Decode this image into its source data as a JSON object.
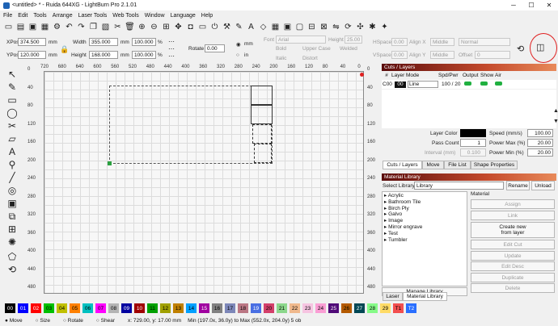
{
  "window": {
    "title": "<untitled> * - Ruida 644XG - LightBurn Pro 2.1.01",
    "controls": [
      "─",
      "☐",
      "✕"
    ]
  },
  "menu": [
    "File",
    "Edit",
    "Tools",
    "Arrange",
    "Laser Tools",
    "Web Tools",
    "Window",
    "Language",
    "Help"
  ],
  "toolbar_icons": [
    "open-icon",
    "import-icon",
    "save-icon",
    "save-as-icon",
    "settings-icon",
    "undo-icon",
    "redo-icon",
    "copy-icon",
    "paste-icon",
    "cut-icon",
    "delete-icon",
    "zoom-in-icon",
    "zoom-out-icon",
    "zoom-frame-icon",
    "pan-icon",
    "camera-icon",
    "monitor-icon",
    "power-icon",
    "tools-icon",
    "wand-icon",
    "text-icon",
    "node-icon",
    "grid-icon",
    "group-icon",
    "ungroup-icon",
    "align-icon",
    "distribute-icon",
    "mirror-icon",
    "rotate-icon",
    "optimize-icon",
    "laser-icon",
    "help-icon"
  ],
  "props": {
    "xpos_label": "XPos",
    "xpos": "374.500",
    "ypos_label": "YPos",
    "ypos": "120.000",
    "unit": "mm",
    "width_label": "Width",
    "width": "355.000",
    "height_label": "Height",
    "height": "168.000",
    "scale_w": "100.000",
    "scale_h": "100.000",
    "pct": "%",
    "rotate_label": "Rotate",
    "rotate": "0.00",
    "mm_label": "mm",
    "in_label": "in",
    "font_label": "Font",
    "font": "Arial",
    "fheight_label": "Height",
    "fheight": "25.00",
    "bold": "Bold",
    "italic": "Italic",
    "upper": "Upper Case",
    "welded": "Welded",
    "distort": "Distort",
    "hspace_label": "HSpace",
    "hspace": "0.00",
    "vspace_label": "VSpace",
    "vspace": "0.00",
    "alignx_label": "Align X",
    "alignx": "Middle",
    "aligny_label": "Align Y",
    "aligny": "Middle",
    "normal": "Normal",
    "offset_label": "Offset",
    "offset": "0"
  },
  "ruler": {
    "top": [
      "720",
      "680",
      "640",
      "600",
      "560",
      "520",
      "480",
      "440",
      "400",
      "360",
      "320",
      "280",
      "240",
      "200",
      "160",
      "120",
      "80",
      "40",
      "0"
    ],
    "left": [
      "0",
      "40",
      "80",
      "120",
      "160",
      "200",
      "240",
      "280",
      "320",
      "360",
      "400",
      "440",
      "480"
    ],
    "right": [
      "720",
      "680",
      "640",
      "600",
      "560",
      "520",
      "480",
      "440",
      "400",
      "360",
      "320",
      "280",
      "240",
      "200",
      "160",
      "120",
      "80",
      "40",
      "0"
    ],
    "rightside": [
      "0",
      "40",
      "80",
      "120",
      "160",
      "200",
      "240",
      "280",
      "320",
      "360",
      "400",
      "440",
      "480"
    ]
  },
  "cuts": {
    "title": "Cuts / Layers",
    "headers": [
      "#",
      "Layer",
      "Mode",
      "Spd/Pwr",
      "Output",
      "Show",
      "Air"
    ],
    "row": {
      "num": "C00",
      "layer": "00",
      "mode": "Line",
      "spd": "100 / 20"
    },
    "layer_color_label": "Layer Color",
    "speed_label": "Speed (mm/s)",
    "speed": "100.00",
    "pass_label": "Pass Count",
    "pass": "1",
    "pmax_label": "Power Max (%)",
    "pmax": "20.00",
    "interval_label": "Interval (mm)",
    "interval": "0.100",
    "pmin_label": "Power Min (%)",
    "pmin": "20.00"
  },
  "tabs1": [
    "Cuts / Layers",
    "Move",
    "File List",
    "Shape Properties"
  ],
  "material": {
    "title": "Material Library",
    "select_label": "Select Library",
    "library": "Library",
    "rename": "Rename",
    "unload": "Unload",
    "items": [
      "Acrylic",
      "Bathroom Tile",
      "Birch Ply",
      "Galvo",
      "Image",
      "Mirror engrave",
      "Test",
      "Tumbler"
    ],
    "section": "Material",
    "buttons": [
      "Assign",
      "Link",
      "Create new\nfrom layer",
      "Edit Cut",
      "Update",
      "Edit Desc",
      "Duplicate",
      "Delete"
    ],
    "manage": "Manage Library"
  },
  "tabs2": [
    "Laser",
    "Material Library"
  ],
  "palette": [
    {
      "n": "00",
      "c": "#000000",
      "t": "#ffffff"
    },
    {
      "n": "01",
      "c": "#0000ff",
      "t": "#ffffff"
    },
    {
      "n": "02",
      "c": "#ff0000",
      "t": "#ffffff"
    },
    {
      "n": "03",
      "c": "#00c000",
      "t": "#000000"
    },
    {
      "n": "04",
      "c": "#c0c000",
      "t": "#000000"
    },
    {
      "n": "05",
      "c": "#ff8000",
      "t": "#000000"
    },
    {
      "n": "06",
      "c": "#00c0c0",
      "t": "#000000"
    },
    {
      "n": "07",
      "c": "#ff00ff",
      "t": "#000000"
    },
    {
      "n": "08",
      "c": "#b4b4b4",
      "t": "#000000"
    },
    {
      "n": "09",
      "c": "#0000a0",
      "t": "#ffffff"
    },
    {
      "n": "10",
      "c": "#a00000",
      "t": "#ffffff"
    },
    {
      "n": "11",
      "c": "#00a000",
      "t": "#000000"
    },
    {
      "n": "12",
      "c": "#a0a000",
      "t": "#000000"
    },
    {
      "n": "13",
      "c": "#c08000",
      "t": "#000000"
    },
    {
      "n": "14",
      "c": "#00a0ff",
      "t": "#000000"
    },
    {
      "n": "15",
      "c": "#a000a0",
      "t": "#ffffff"
    },
    {
      "n": "16",
      "c": "#808080",
      "t": "#000000"
    },
    {
      "n": "17",
      "c": "#7d87b9",
      "t": "#000000"
    },
    {
      "n": "18",
      "c": "#bb7784",
      "t": "#000000"
    },
    {
      "n": "19",
      "c": "#4a6fe3",
      "t": "#ffffff"
    },
    {
      "n": "20",
      "c": "#d33f6a",
      "t": "#000000"
    },
    {
      "n": "21",
      "c": "#8cd78c",
      "t": "#000000"
    },
    {
      "n": "22",
      "c": "#f0b98d",
      "t": "#000000"
    },
    {
      "n": "23",
      "c": "#f6c4e1",
      "t": "#000000"
    },
    {
      "n": "24",
      "c": "#fa9ed4",
      "t": "#000000"
    },
    {
      "n": "25",
      "c": "#500a78",
      "t": "#ffffff"
    },
    {
      "n": "26",
      "c": "#b45a00",
      "t": "#000000"
    },
    {
      "n": "27",
      "c": "#004754",
      "t": "#ffffff"
    },
    {
      "n": "28",
      "c": "#86fa88",
      "t": "#000000"
    },
    {
      "n": "29",
      "c": "#ffdb66",
      "t": "#000000"
    },
    {
      "n": "T1",
      "c": "#f34f4f",
      "t": "#000000"
    },
    {
      "n": "T2",
      "c": "#2a6fff",
      "t": "#ffffff"
    }
  ],
  "status": {
    "move": "Move",
    "size": "Size",
    "rotate": "Rotate",
    "shear": "Shear",
    "coords": "x: 729.00, y: 17.00 mm",
    "bounds": "Min (197.0x, 36.0y) to Max (552.0x, 204.0y)  5 ob"
  }
}
